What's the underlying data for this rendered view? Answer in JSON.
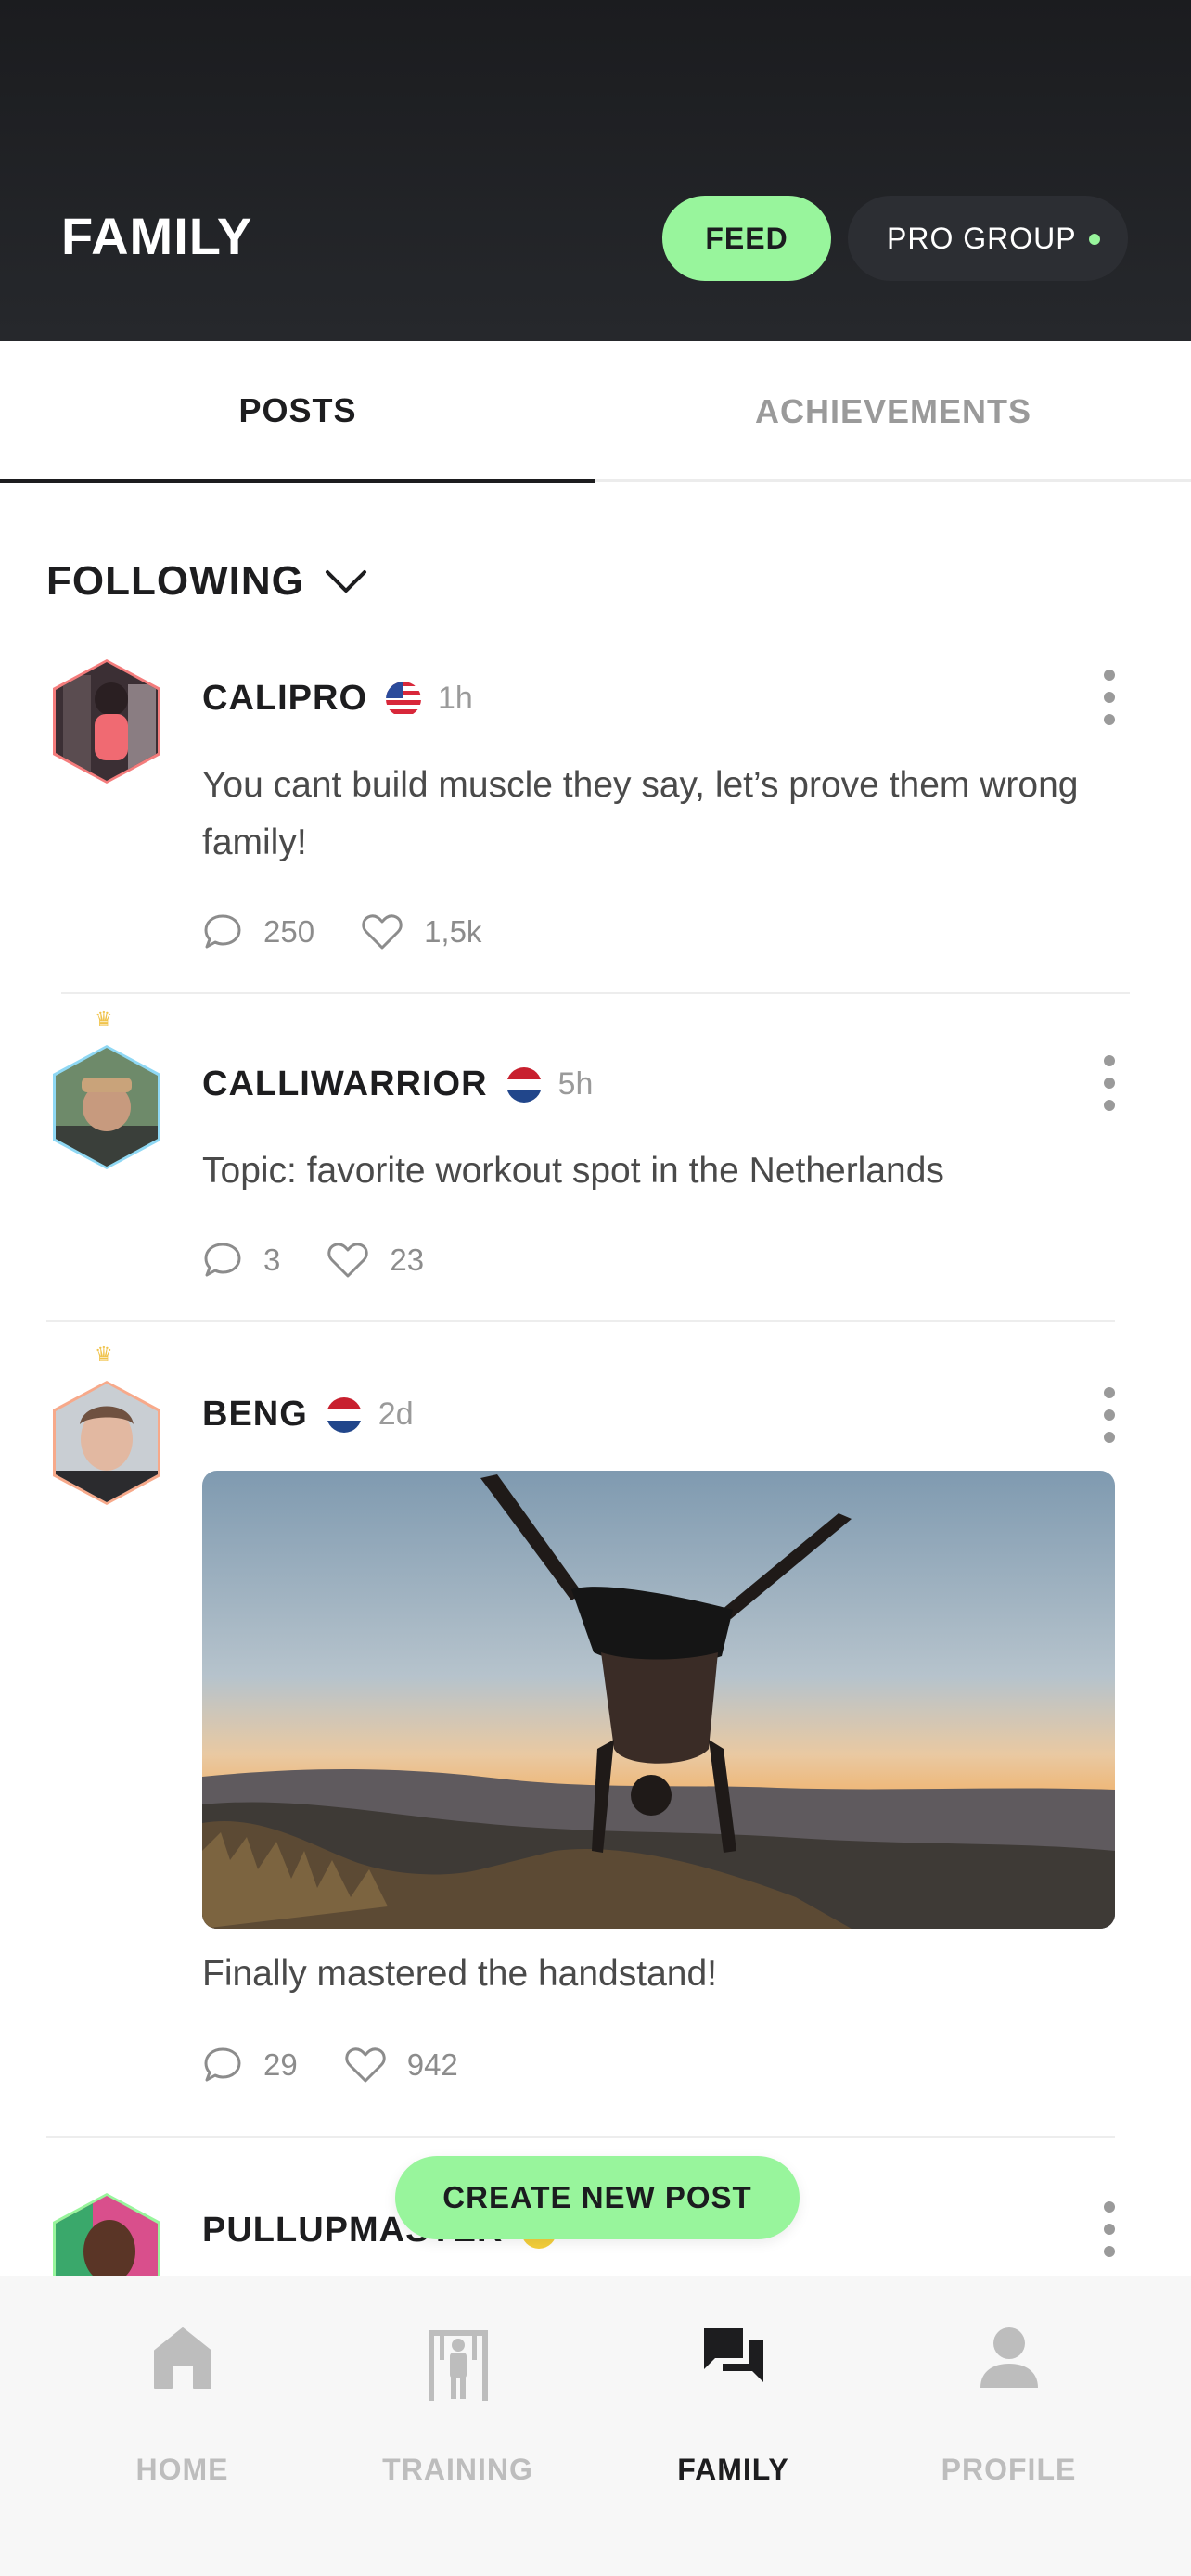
{
  "header": {
    "title": "FAMILY",
    "feed_label": "FEED",
    "pro_group_label": "PRO GROUP",
    "accent_color": "#98f59c"
  },
  "tabs": [
    {
      "label": "POSTS",
      "active": true
    },
    {
      "label": "ACHIEVEMENTS",
      "active": false
    }
  ],
  "filter": {
    "label": "FOLLOWING",
    "icon": "chevron-down-icon"
  },
  "posts": [
    {
      "author": "CALIPRO",
      "flag": "us-flag-icon",
      "time": "1h",
      "text": "You cant build muscle they say, let’s prove them wrong family!",
      "comments": "250",
      "likes": "1,5k",
      "crown": false,
      "avatar_border": "#f47c7c"
    },
    {
      "author": "CALLIWARRIOR",
      "flag": "nl-flag-icon",
      "time": "5h",
      "text": "Topic: favorite workout spot in the Netherlands",
      "comments": "3",
      "likes": "23",
      "crown": true,
      "avatar_border": "#8fd8f4"
    },
    {
      "author": "BENG",
      "flag": "nl-flag-icon",
      "time": "2d",
      "text": "Finally mastered the handstand!",
      "comments": "29",
      "likes": "942",
      "crown": true,
      "avatar_border": "#f7a98a",
      "has_image": true
    },
    {
      "author": "PULLUPMASTER",
      "flag": "yellow-badge-icon",
      "crown": false,
      "avatar_border": "#98f59c"
    }
  ],
  "create_post_label": "CREATE NEW POST",
  "bottom_nav": [
    {
      "label": "HOME",
      "icon": "home-icon",
      "active": false
    },
    {
      "label": "TRAINING",
      "icon": "pullup-bar-icon",
      "active": false
    },
    {
      "label": "FAMILY",
      "icon": "chat-bubbles-icon",
      "active": true
    },
    {
      "label": "PROFILE",
      "icon": "person-icon",
      "active": false
    }
  ]
}
